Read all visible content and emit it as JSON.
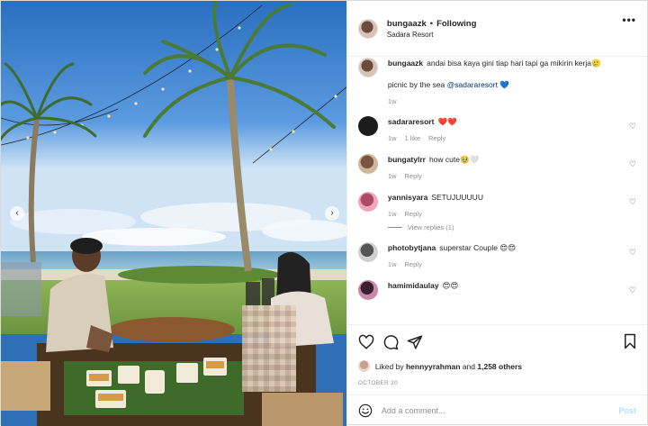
{
  "post": {
    "username": "bungaazk",
    "dot": "•",
    "follow_status": "Following",
    "location": "Sadara Resort",
    "more": "•••"
  },
  "caption": {
    "username": "bungaazk",
    "text": "andai bisa kaya gini tiap hari tapi ga mikirin kerja🥲",
    "line2_text": "picnic by the sea",
    "line2_mention": "@sadararesort",
    "line2_emoji": "💙",
    "time": "1w"
  },
  "comments": [
    {
      "username": "sadararesort",
      "text": "❤️❤️",
      "time": "1w",
      "likes": "1 like",
      "reply": "Reply",
      "avatar_color": "#1c1c1c"
    },
    {
      "username": "bungatylrr",
      "text": "how cute🥹🤍",
      "time": "1w",
      "likes": "",
      "reply": "Reply",
      "avatar_color": "#a57a5e"
    },
    {
      "username": "yannisyara",
      "text": "SETUJUUUUU",
      "time": "1w",
      "likes": "",
      "reply": "Reply",
      "avatar_color": "#d86b8d",
      "view_replies": "View replies (1)"
    },
    {
      "username": "photobytjana",
      "text": "superstar Couple 😍😍",
      "time": "1w",
      "likes": "",
      "reply": "Reply",
      "avatar_color": "#9a9a9a"
    },
    {
      "username": "hamimidaulay",
      "text": "😍😍",
      "time": "",
      "likes": "",
      "reply": "",
      "avatar_color": "#5a2a4a"
    }
  ],
  "actions": {
    "like_icon": "heart-icon",
    "comment_icon": "comment-icon",
    "share_icon": "share-icon",
    "save_icon": "bookmark-icon"
  },
  "likes": {
    "prefix": "Liked by",
    "user": "hennyyrahman",
    "connector": "and",
    "others": "1,258 others"
  },
  "date": "OCTOBER 20",
  "add_comment": {
    "placeholder": "Add a comment...",
    "post_label": "Post",
    "emoji_icon": "smiley-icon"
  },
  "carousel": {
    "prev": "‹",
    "next": "›"
  },
  "colors": {
    "link": "#00376b",
    "post_button": "#b2dffc",
    "muted": "#8e8e8e"
  }
}
